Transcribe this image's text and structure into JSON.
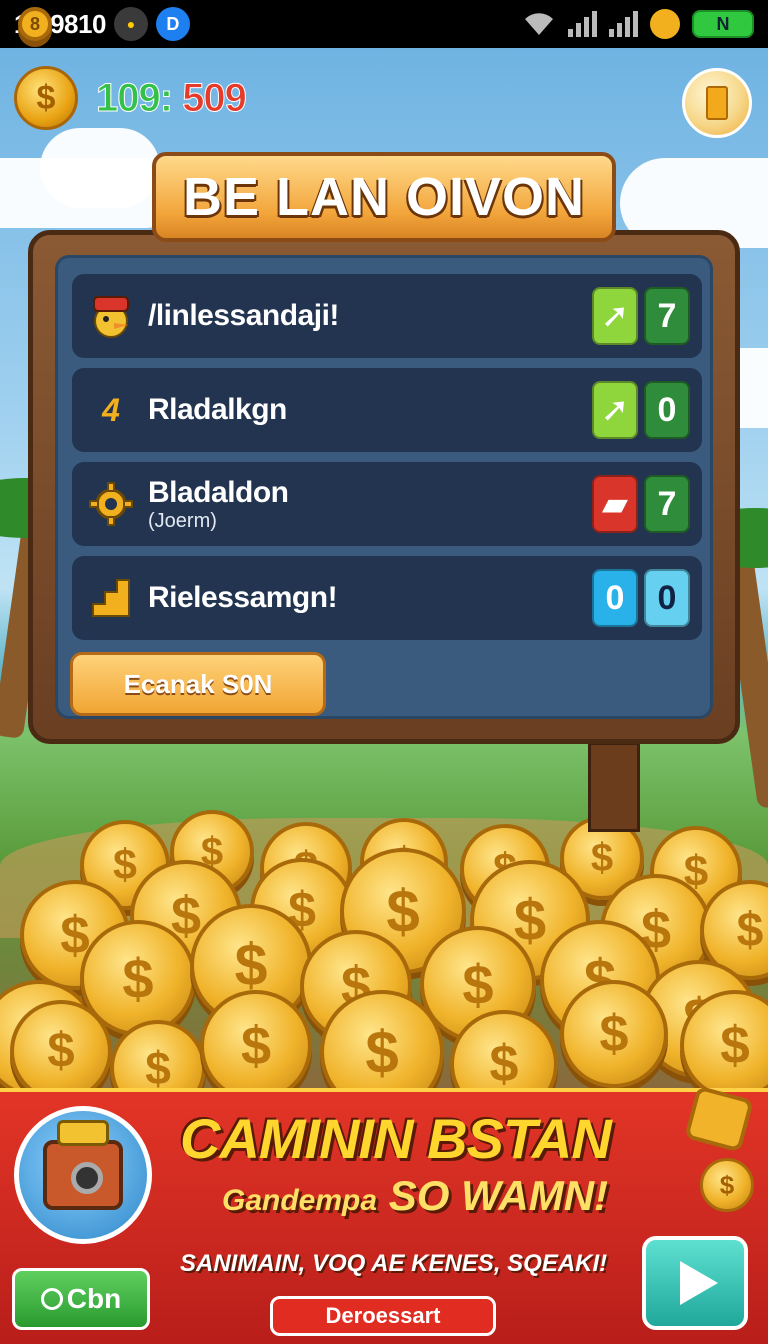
{
  "status_bar": {
    "time": "14;9810",
    "badge_coin": "8",
    "badge_blue": "D",
    "battery_label": "N"
  },
  "hud": {
    "currency_symbol": "$",
    "score_left": "109:",
    "score_right": "509"
  },
  "board": {
    "title": "BE LAN OIVON",
    "rows": [
      {
        "icon": "pirate-duck-icon",
        "name": "/linlessandaji!",
        "sub": "",
        "tile1": "",
        "tile2": "7"
      },
      {
        "icon": "number-4-icon",
        "icon_text": "4",
        "name": "Rladalkgn",
        "sub": "",
        "tile1": "",
        "tile2": "0"
      },
      {
        "icon": "gear-icon",
        "name": "Bladaldon",
        "sub": "(Joerm)",
        "tile1": "",
        "tile2": "7"
      },
      {
        "icon": "stairs-icon",
        "name": "Rielessamgn!",
        "sub": "",
        "tile1": "0",
        "tile2": "0"
      }
    ],
    "button_label": "Ecanak S0N"
  },
  "coins": {
    "symbol": "$"
  },
  "ad": {
    "title": "CAMININ BSTAN",
    "sub_small": "Gandempa",
    "sub_big": "SO WAMN!",
    "text": "SANIMAIN, VOQ AE KENES, SQEAKI!",
    "cta": "Deroessart",
    "left_button": "Cbn",
    "coin_symbol": "$"
  },
  "colors": {
    "score_left": "#35c04a",
    "score_right": "#e63a2a",
    "board_wood": "#6a3f22",
    "board_panel": "#3a5b7e",
    "ad_red": "#d12a20",
    "ad_yellow": "#ffd62e"
  }
}
